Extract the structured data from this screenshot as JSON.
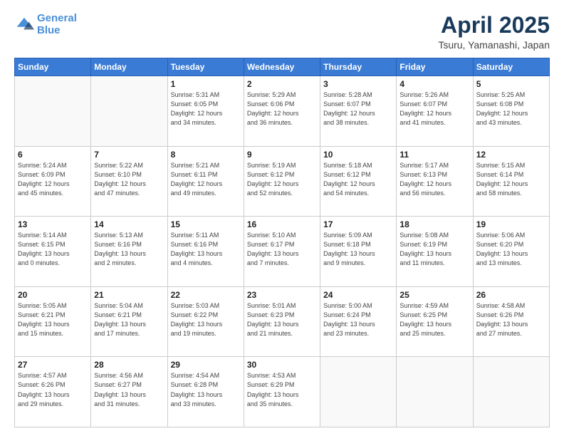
{
  "header": {
    "logo_line1": "General",
    "logo_line2": "Blue",
    "title": "April 2025",
    "subtitle": "Tsuru, Yamanashi, Japan"
  },
  "calendar": {
    "days_of_week": [
      "Sunday",
      "Monday",
      "Tuesday",
      "Wednesday",
      "Thursday",
      "Friday",
      "Saturday"
    ],
    "weeks": [
      [
        {
          "day": "",
          "detail": ""
        },
        {
          "day": "",
          "detail": ""
        },
        {
          "day": "1",
          "detail": "Sunrise: 5:31 AM\nSunset: 6:05 PM\nDaylight: 12 hours\nand 34 minutes."
        },
        {
          "day": "2",
          "detail": "Sunrise: 5:29 AM\nSunset: 6:06 PM\nDaylight: 12 hours\nand 36 minutes."
        },
        {
          "day": "3",
          "detail": "Sunrise: 5:28 AM\nSunset: 6:07 PM\nDaylight: 12 hours\nand 38 minutes."
        },
        {
          "day": "4",
          "detail": "Sunrise: 5:26 AM\nSunset: 6:07 PM\nDaylight: 12 hours\nand 41 minutes."
        },
        {
          "day": "5",
          "detail": "Sunrise: 5:25 AM\nSunset: 6:08 PM\nDaylight: 12 hours\nand 43 minutes."
        }
      ],
      [
        {
          "day": "6",
          "detail": "Sunrise: 5:24 AM\nSunset: 6:09 PM\nDaylight: 12 hours\nand 45 minutes."
        },
        {
          "day": "7",
          "detail": "Sunrise: 5:22 AM\nSunset: 6:10 PM\nDaylight: 12 hours\nand 47 minutes."
        },
        {
          "day": "8",
          "detail": "Sunrise: 5:21 AM\nSunset: 6:11 PM\nDaylight: 12 hours\nand 49 minutes."
        },
        {
          "day": "9",
          "detail": "Sunrise: 5:19 AM\nSunset: 6:12 PM\nDaylight: 12 hours\nand 52 minutes."
        },
        {
          "day": "10",
          "detail": "Sunrise: 5:18 AM\nSunset: 6:12 PM\nDaylight: 12 hours\nand 54 minutes."
        },
        {
          "day": "11",
          "detail": "Sunrise: 5:17 AM\nSunset: 6:13 PM\nDaylight: 12 hours\nand 56 minutes."
        },
        {
          "day": "12",
          "detail": "Sunrise: 5:15 AM\nSunset: 6:14 PM\nDaylight: 12 hours\nand 58 minutes."
        }
      ],
      [
        {
          "day": "13",
          "detail": "Sunrise: 5:14 AM\nSunset: 6:15 PM\nDaylight: 13 hours\nand 0 minutes."
        },
        {
          "day": "14",
          "detail": "Sunrise: 5:13 AM\nSunset: 6:16 PM\nDaylight: 13 hours\nand 2 minutes."
        },
        {
          "day": "15",
          "detail": "Sunrise: 5:11 AM\nSunset: 6:16 PM\nDaylight: 13 hours\nand 4 minutes."
        },
        {
          "day": "16",
          "detail": "Sunrise: 5:10 AM\nSunset: 6:17 PM\nDaylight: 13 hours\nand 7 minutes."
        },
        {
          "day": "17",
          "detail": "Sunrise: 5:09 AM\nSunset: 6:18 PM\nDaylight: 13 hours\nand 9 minutes."
        },
        {
          "day": "18",
          "detail": "Sunrise: 5:08 AM\nSunset: 6:19 PM\nDaylight: 13 hours\nand 11 minutes."
        },
        {
          "day": "19",
          "detail": "Sunrise: 5:06 AM\nSunset: 6:20 PM\nDaylight: 13 hours\nand 13 minutes."
        }
      ],
      [
        {
          "day": "20",
          "detail": "Sunrise: 5:05 AM\nSunset: 6:21 PM\nDaylight: 13 hours\nand 15 minutes."
        },
        {
          "day": "21",
          "detail": "Sunrise: 5:04 AM\nSunset: 6:21 PM\nDaylight: 13 hours\nand 17 minutes."
        },
        {
          "day": "22",
          "detail": "Sunrise: 5:03 AM\nSunset: 6:22 PM\nDaylight: 13 hours\nand 19 minutes."
        },
        {
          "day": "23",
          "detail": "Sunrise: 5:01 AM\nSunset: 6:23 PM\nDaylight: 13 hours\nand 21 minutes."
        },
        {
          "day": "24",
          "detail": "Sunrise: 5:00 AM\nSunset: 6:24 PM\nDaylight: 13 hours\nand 23 minutes."
        },
        {
          "day": "25",
          "detail": "Sunrise: 4:59 AM\nSunset: 6:25 PM\nDaylight: 13 hours\nand 25 minutes."
        },
        {
          "day": "26",
          "detail": "Sunrise: 4:58 AM\nSunset: 6:26 PM\nDaylight: 13 hours\nand 27 minutes."
        }
      ],
      [
        {
          "day": "27",
          "detail": "Sunrise: 4:57 AM\nSunset: 6:26 PM\nDaylight: 13 hours\nand 29 minutes."
        },
        {
          "day": "28",
          "detail": "Sunrise: 4:56 AM\nSunset: 6:27 PM\nDaylight: 13 hours\nand 31 minutes."
        },
        {
          "day": "29",
          "detail": "Sunrise: 4:54 AM\nSunset: 6:28 PM\nDaylight: 13 hours\nand 33 minutes."
        },
        {
          "day": "30",
          "detail": "Sunrise: 4:53 AM\nSunset: 6:29 PM\nDaylight: 13 hours\nand 35 minutes."
        },
        {
          "day": "",
          "detail": ""
        },
        {
          "day": "",
          "detail": ""
        },
        {
          "day": "",
          "detail": ""
        }
      ]
    ]
  }
}
